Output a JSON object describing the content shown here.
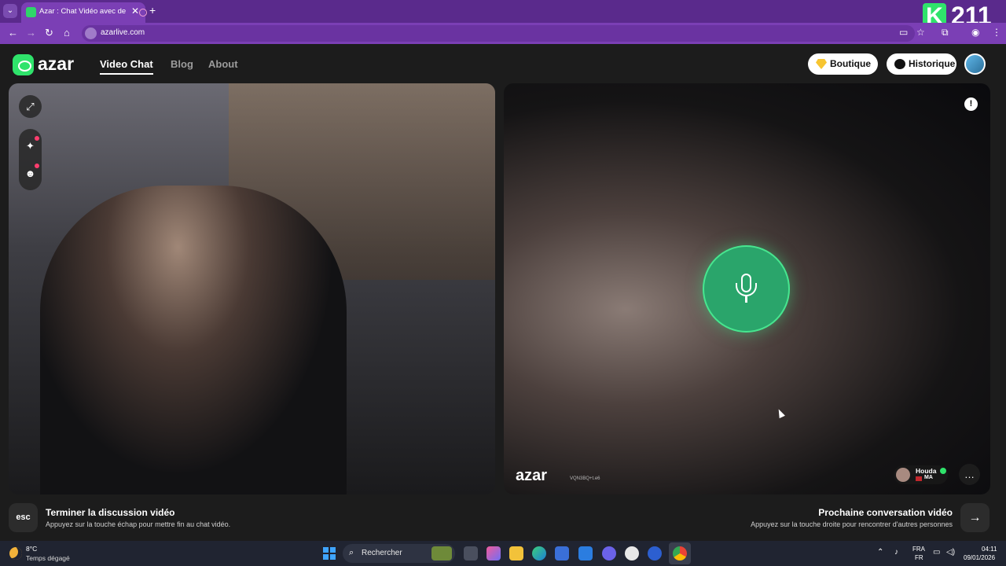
{
  "browser": {
    "tab_title": "Azar : Chat Vidéo avec de n",
    "url": "azarlive.com",
    "accent_color": "#7b3fb5"
  },
  "overlay": {
    "badge_letter": "K",
    "badge_number": "211"
  },
  "header": {
    "brand": "azar",
    "nav": [
      {
        "label": "Video Chat",
        "active": true
      },
      {
        "label": "Blog",
        "active": false
      },
      {
        "label": "About",
        "active": false
      }
    ],
    "shop_label": "Boutique",
    "history_label": "Historique"
  },
  "right_video": {
    "watermark": "azar",
    "watermark_code": "VQN3BQ+t.e6",
    "partner_name": "Houda",
    "partner_country": "MA",
    "mic_color": "#2aa56b"
  },
  "bottom": {
    "esc_key": "esc",
    "end_title": "Terminer la discussion vidéo",
    "end_hint": "Appuyez sur la touche échap pour mettre fin au chat vidéo.",
    "next_title": "Prochaine conversation vidéo",
    "next_hint": "Appuyez sur la touche droite pour rencontrer d'autres personnes"
  },
  "taskbar": {
    "temperature": "8°C",
    "condition": "Temps dégagé",
    "search_placeholder": "Rechercher",
    "lang_top": "FRA",
    "lang_bottom": "FR",
    "time": "04:11",
    "date": "09/01/2026"
  }
}
